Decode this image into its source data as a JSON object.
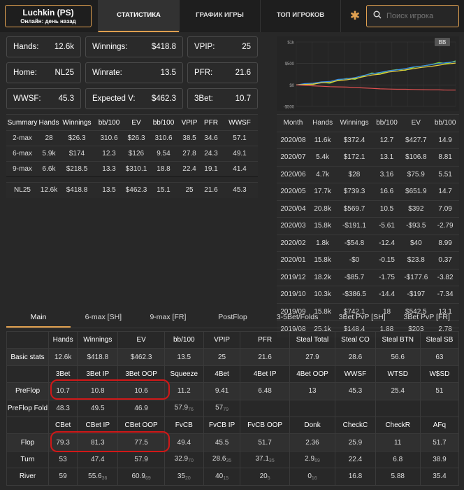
{
  "player": {
    "name": "Luchkin (PS)",
    "status": "Онлайн: день назад"
  },
  "nav": [
    "СТАТИСТИКА",
    "ГРАФИК ИГРЫ",
    "ТОП ИГРОКОВ"
  ],
  "search": {
    "placeholder": "Поиск игрока"
  },
  "stats": {
    "hands": {
      "label": "Hands:",
      "value": "12.6k"
    },
    "winnings": {
      "label": "Winnings:",
      "value": "$418.8"
    },
    "vpip": {
      "label": "VPIP:",
      "value": "25"
    },
    "home": {
      "label": "Home:",
      "value": "NL25"
    },
    "winrate": {
      "label": "Winrate:",
      "value": "13.5"
    },
    "pfr": {
      "label": "PFR:",
      "value": "21.6"
    },
    "wwsf": {
      "label": "WWSF:",
      "value": "45.3"
    },
    "expected": {
      "label": "Expected V:",
      "value": "$462.3"
    },
    "threebet": {
      "label": "3Bet:",
      "value": "10.7"
    }
  },
  "summary": {
    "headers": [
      "Summary",
      "Hands",
      "Winnings",
      "bb/100",
      "EV",
      "bb/100",
      "VPIP",
      "PFR",
      "WWSF"
    ],
    "rows": [
      [
        "2-max",
        "28",
        "$26.3",
        "310.6",
        "$26.3",
        "310.6",
        "38.5",
        "34.6",
        "57.1"
      ],
      [
        "6-max",
        "5.9k",
        "$174",
        "12.3",
        "$126",
        "9.54",
        "27.8",
        "24.3",
        "49.1"
      ],
      [
        "9-max",
        "6.6k",
        "$218.5",
        "13.3",
        "$310.1",
        "18.8",
        "22.4",
        "19.1",
        "41.4"
      ]
    ],
    "total": [
      "NL25",
      "12.6k",
      "$418.8",
      "13.5",
      "$462.3",
      "15.1",
      "25",
      "21.6",
      "45.3"
    ]
  },
  "chart_data": {
    "type": "line",
    "badge": "BB",
    "yticks": [
      "$1k",
      "$500",
      "$0",
      "-$500"
    ],
    "ylim": [
      -500,
      1000
    ],
    "series": [
      {
        "color": "#7cd637",
        "values": [
          0,
          20,
          10,
          60,
          40,
          110,
          150,
          130,
          210,
          280,
          260,
          330,
          360,
          340,
          410,
          440,
          470,
          520,
          500,
          560
        ]
      },
      {
        "color": "#3a8ee8",
        "values": [
          0,
          30,
          40,
          70,
          80,
          130,
          140,
          170,
          220,
          260,
          290,
          330,
          350,
          380,
          420,
          440,
          470,
          500,
          520,
          540
        ]
      },
      {
        "color": "#e8d040",
        "values": [
          0,
          10,
          20,
          50,
          60,
          100,
          120,
          150,
          190,
          230,
          250,
          300,
          320,
          350,
          380,
          410,
          430,
          460,
          490,
          510
        ]
      },
      {
        "color": "#e05050",
        "values": [
          0,
          -10,
          -20,
          -30,
          -40,
          -45,
          -50,
          -60,
          -70,
          -80,
          -90,
          -95,
          -100,
          -100,
          -105,
          -110,
          -115,
          -115,
          -120,
          -120
        ]
      }
    ]
  },
  "months": {
    "headers": [
      "Month",
      "Hands",
      "Winnings",
      "bb/100",
      "EV",
      "bb/100"
    ],
    "rows": [
      [
        "2020/08",
        "11.6k",
        "$372.4",
        "12.7",
        "$427.7",
        "14.9"
      ],
      [
        "2020/07",
        "5.4k",
        "$172.1",
        "13.1",
        "$106.8",
        "8.81"
      ],
      [
        "2020/06",
        "4.7k",
        "$28",
        "3.16",
        "$75.9",
        "5.51"
      ],
      [
        "2020/05",
        "17.7k",
        "$739.3",
        "16.6",
        "$651.9",
        "14.7"
      ],
      [
        "2020/04",
        "20.8k",
        "$569.7",
        "10.5",
        "$392",
        "7.09"
      ],
      [
        "2020/03",
        "15.8k",
        "-$191.1",
        "-5.61",
        "-$93.5",
        "-2.79"
      ],
      [
        "2020/02",
        "1.8k",
        "-$54.8",
        "-12.4",
        "$40",
        "8.99"
      ],
      [
        "2020/01",
        "15.8k",
        "-$0",
        "-0.15",
        "$23.8",
        "0.37"
      ],
      [
        "2019/12",
        "18.2k",
        "-$85.7",
        "-1.75",
        "-$177.6",
        "-3.82"
      ],
      [
        "2019/10",
        "10.3k",
        "-$386.5",
        "-14.4",
        "-$197",
        "-7.34"
      ],
      [
        "2019/09",
        "15.8k",
        "$742.1",
        "18",
        "$542.5",
        "13.1"
      ],
      [
        "2019/08",
        "25.1k",
        "$148.4",
        "1.88",
        "$203",
        "2.78"
      ]
    ]
  },
  "bottom_tabs": [
    "Main",
    "6-max [SH]",
    "9-max [FR]",
    "PostFlop",
    "3-5Bet/Folds",
    "3Bet PvP [SH]",
    "3Bet PvP [FR]"
  ],
  "main": {
    "h1": [
      "Hands",
      "Winnings",
      "EV",
      "bb/100",
      "VPIP",
      "PFR",
      "Steal Total",
      "Steal CO",
      "Steal BTN",
      "Steal SB"
    ],
    "basic": {
      "label": "Basic stats",
      "values": [
        "12.6k",
        "$418.8",
        "$462.3",
        "13.5",
        "25",
        "21.6",
        "27.9",
        "28.6",
        "56.6",
        "63"
      ]
    },
    "h2": [
      "3Bet",
      "3Bet IP",
      "3Bet OOP",
      "Squeeze",
      "4Bet",
      "4Bet IP",
      "4Bet OOP",
      "WWSF",
      "WTSD",
      "W$SD"
    ],
    "preflop": {
      "label": "PreFlop",
      "values": [
        "10.7",
        "10.8",
        "10.6",
        "11.2",
        "9.41",
        "6.48",
        "13",
        "45.3",
        "25.4",
        "51"
      ]
    },
    "pffold": {
      "label": "PreFlop Fold",
      "values": [
        "48.3",
        "49.5",
        "46.9",
        "57.9",
        "57",
        "",
        "",
        "",
        "",
        ""
      ],
      "subs": [
        "",
        "",
        "",
        "76",
        "79",
        "",
        "",
        "",
        "",
        ""
      ]
    },
    "h3": [
      "CBet",
      "CBet IP",
      "CBet OOP",
      "FvCB",
      "FvCB IP",
      "FvCB OOP",
      "Donk",
      "CheckC",
      "CheckR",
      "AFq"
    ],
    "flop": {
      "label": "Flop",
      "values": [
        "79.3",
        "81.3",
        "77.5",
        "49.4",
        "45.5",
        "51.7",
        "2.36",
        "25.9",
        "11",
        "51.7"
      ]
    },
    "turn": {
      "label": "Turn",
      "values": [
        "53",
        "47.4",
        "57.9",
        "32.9",
        "28.6",
        "37.1",
        "2.9",
        "22.4",
        "6.8",
        "38.9"
      ],
      "subs": [
        "",
        "",
        "",
        "70",
        "35",
        "35",
        "69",
        "",
        "",
        ""
      ]
    },
    "river": {
      "label": "River",
      "values": [
        "59",
        "55.6",
        "60.9",
        "35",
        "40",
        "20",
        "0",
        "16.8",
        "5.88",
        "35.4"
      ],
      "subs": [
        "",
        "36",
        "69",
        "20",
        "15",
        "5",
        "16",
        "",
        "",
        ""
      ]
    }
  }
}
